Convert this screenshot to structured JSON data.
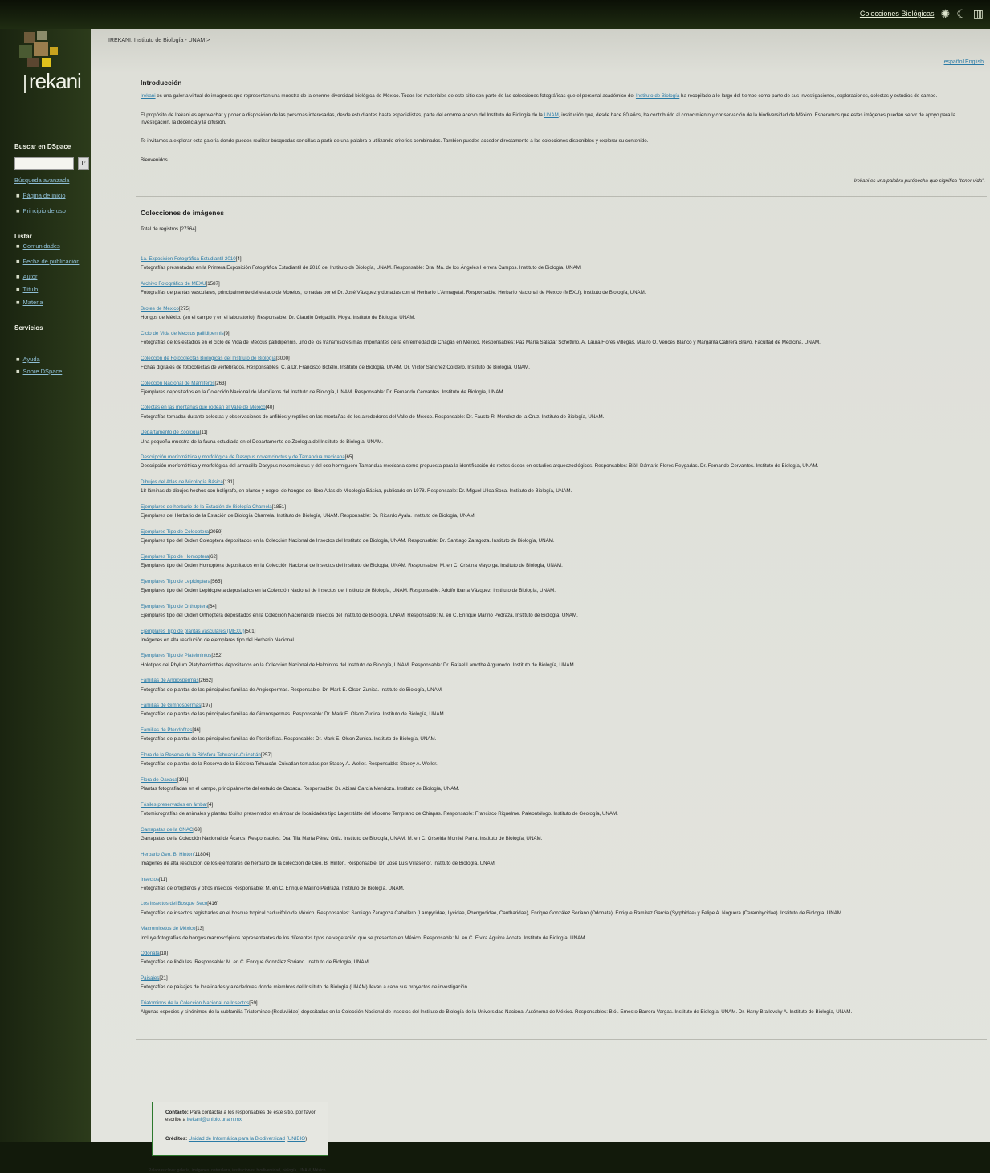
{
  "topbar": {
    "link": "Colecciones Biológicas",
    "icons": [
      "unam-seal-icon",
      "moon-icon",
      "building-icon"
    ]
  },
  "sidebar": {
    "logo_text": "rekani",
    "search": {
      "heading": "Buscar en DSpace",
      "button": "Ir",
      "advanced": "Búsqueda avanzada"
    },
    "top_links": [
      "Página de inicio",
      "Principio de uso"
    ],
    "listar": {
      "heading": "Listar",
      "items": [
        "Comunidades",
        "Fecha de publicación",
        "Autor",
        "Título",
        "Materia"
      ]
    },
    "servicios": {
      "heading": "Servicios",
      "items": [
        "Ayuda",
        "Sobre DSpace"
      ]
    }
  },
  "main": {
    "breadcrumb": "IREKANI. Instituto de Biología - UNAM >",
    "languages": "español English",
    "intro": {
      "heading": "Introducción",
      "p1_pre": "Irekani",
      "p1_a": " es una galería virtual de imágenes que representan una muestra de la enorme diversidad biológica de México. Todos los materiales de este sitio son parte de las colecciones fotográficas que el personal académico del ",
      "p1_link": "Instituto de Biología",
      "p1_b": " ha recopilado a lo largo del tiempo como parte de sus investigaciones, exploraciones, colectas y estudios de campo.",
      "p2_a": "El propósito de Irekani es aprovechar y poner a disposición de las personas interesadas, desde estudiantes hasta especialistas, parte del enorme acervo del Instituto de Biología de la ",
      "p2_link": "UNAM",
      "p2_b": ", institución que, desde hace 80 años, ha contribuido al conocimiento y conservación de la biodiversidad de México. Esperamos que estas imágenes puedan servir de apoyo para la investigación, la docencia y la difusión.",
      "p3": "Te invitamos a explorar esta galería donde puedes realizar búsquedas sencillas a partir de una palabra o utilizando criterios combinados. También puedes acceder directamente a las colecciones disponibles y explorar su contenido.",
      "p4": "Bienvenidos.",
      "note": "Irekani es una palabra purépecha que significa \"tener vida\"."
    },
    "collections": {
      "heading": "Colecciones de imágenes",
      "total": "Total de registros [27364]",
      "items": [
        {
          "name": "1a. Exposición Fotográfica Estudiantil 2010",
          "count": "[4]",
          "desc": "Fotografías presentadas en la Primera Exposición Fotográfica Estudiantil de 2010 del Instituto de Biología, UNAM. Responsable: Dra. Ma. de los Ángeles Herrera Campos. Instituto de Biología, UNAM."
        },
        {
          "name": "Archivo Fotográfico de MEXU",
          "count": "[1587]",
          "desc": "Fotografías de plantas vasculares, principalmente del estado de Morelos, tomadas por el Dr. José Vázquez y donadas con el Herbario L'Armagetal. Responsable: Herbario Nacional de México (MEXU). Instituto de Biología, UNAM."
        },
        {
          "name": "Brotes de México",
          "count": "[275]",
          "desc": "Hongos de México (en el campo y en el laboratorio). Responsable: Dr. Claudio Delgadillo Moya. Instituto de Biología, UNAM."
        },
        {
          "name": "Ciclo de Vida de Meccus pallidipennis",
          "count": "[9]",
          "desc": "Fotografías de los estadios en el ciclo de Vida de Meccus pallidipennis, uno de los transmisores más importantes de la enfermedad de Chagas en México. Responsables: Paz María Salazar Schettino, A. Laura Flores Villegas, Mauro O. Vences Blanco y Margarita Cabrera Bravo. Facultad de Medicina, UNAM."
        },
        {
          "name": "Colección de Fotocolectas Biológicas del Instituto de Biología",
          "count": "[3000]",
          "desc": "Fichas digitales de fotocolectas de vertebrados. Responsables: C. a Dr. Francisco Botello. Instituto de Biología, UNAM. Dr. Víctor Sánchez Cordero. Instituto de Biología, UNAM."
        },
        {
          "name": "Colección Nacional de Mamíferos",
          "count": "[263]",
          "desc": "Ejemplares depositados en la Colección Nacional de Mamíferos del Instituto de Biología, UNAM. Responsable: Dr. Fernando Cervantes. Instituto de Biología, UNAM."
        },
        {
          "name": "Colectas en las montañas que rodean el Valle de México",
          "count": "[40]",
          "desc": "Fotografías tomadas durante colectas y observaciones de anfibios y reptiles en las montañas de los alrededores del Valle de México. Responsable: Dr. Fausto R. Méndez de la Cruz. Instituto de Biología, UNAM."
        },
        {
          "name": "Departamento de Zoología",
          "count": "[11]",
          "desc": "Una pequeña muestra de la fauna estudiada en el Departamento de Zoología del Instituto de Biología, UNAM."
        },
        {
          "name": "Descripción morfométrica y morfológica de Dasypus novemcinctus y de Tamandua mexicana",
          "count": "[65]",
          "desc": "Descripción morfométrica y morfológica del armadillo Dasypus novemcinctus y del oso hormiguero Tamandua mexicana como propuesta para la identificación de restos óseos en estudios arqueozoológicos. Responsables: Biól. Dámaris Flores Reygadas. Dr. Fernando Cervantes. Instituto de Biología, UNAM."
        },
        {
          "name": "Dibujos del Atlas de Micología Básica",
          "count": "[131]",
          "desc": "18 láminas de dibujos hechos con bolígrafo, en blanco y negro, de hongos del libro Atlas de Micología Básica, publicado en 1978. Responsable: Dr. Miguel Ulloa Sosa. Instituto de Biología, UNAM."
        },
        {
          "name": "Ejemplares de herbario de la Estación de Biología Chamela",
          "count": "[1851]",
          "desc": "Ejemplares del Herbario de la Estación de Biología Chamela. Instituto de Biología, UNAM. Responsable: Dr. Ricardo Ayala. Instituto de Biología, UNAM."
        },
        {
          "name": "Ejemplares Tipo de Coleoptera",
          "count": "[2059]",
          "desc": "Ejemplares tipo del Orden Coleoptera depositados en la Colección Nacional de Insectos del Instituto de Biología, UNAM. Responsable: Dr. Santiago Zaragoza. Instituto de Biología, UNAM."
        },
        {
          "name": "Ejemplares Tipo de Homoptera",
          "count": "[62]",
          "desc": "Ejemplares tipo del Orden Homoptera depositados en la Colección Nacional de Insectos del Instituto de Biología, UNAM. Responsable: M. en C. Cristina Mayorga. Instituto de Biología, UNAM."
        },
        {
          "name": "Ejemplares Tipo de Lepidoptera",
          "count": "[565]",
          "desc": "Ejemplares tipo del Orden Lepidoptera depositados en la Colección Nacional de Insectos del Instituto de Biología, UNAM. Responsable: Adolfo Ibarra Vázquez. Instituto de Biología, UNAM."
        },
        {
          "name": "Ejemplares Tipo de Orthoptera",
          "count": "[64]",
          "desc": "Ejemplares tipo del Orden Orthoptera depositados en la Colección Nacional de Insectos del Instituto de Biología, UNAM. Responsable: M. en C. Enrique Mariño Pedraza. Instituto de Biología, UNAM."
        },
        {
          "name": "Ejemplares Tipo de plantas vasculares (MEXU)",
          "count": "[501]",
          "desc": "Imágenes en alta resolución de ejemplares tipo del Herbario Nacional."
        },
        {
          "name": "Ejemplares Tipo de Platelmintos",
          "count": "[252]",
          "desc": "Holotipos del Phylum Platyhelminthes depositados en la Colección Nacional de Helmintos del Instituto de Biología, UNAM. Responsable: Dr. Rafael Lamothe Argumedo. Instituto de Biología, UNAM."
        },
        {
          "name": "Familias de Angiospermas",
          "count": "[2662]",
          "desc": "Fotografías de plantas de las principales familias de Angiospermas. Responsable: Dr. Mark E. Olson Zunica. Instituto de Biología, UNAM."
        },
        {
          "name": "Familias de Gimnospermas",
          "count": "[197]",
          "desc": "Fotografías de plantas de las principales familias de Gimnospermas. Responsable: Dr. Mark E. Olson Zunica. Instituto de Biología, UNAM."
        },
        {
          "name": "Familias de Pteridofitas",
          "count": "[46]",
          "desc": "Fotografías de plantas de las principales familias de Pteridofitas. Responsable: Dr. Mark E. Olson Zunica. Instituto de Biología, UNAM."
        },
        {
          "name": "Flora de la Reserva de la Biósfera Tehuacán-Cuicatlán",
          "count": "[257]",
          "desc": "Fotografías de plantas de la Reserva de la Biósfera Tehuacán-Cuicatlán tomadas por Stacey A. Weller. Responsable: Stacey A. Weller."
        },
        {
          "name": "Flora de Oaxaca",
          "count": "[191]",
          "desc": "Plantas fotografiadas en el campo, principalmente del estado de Oaxaca. Responsable: Dr. Abisaí García Mendoza. Instituto de Biología, UNAM."
        },
        {
          "name": "Fósiles preservados en ámbar",
          "count": "[4]",
          "desc": "Fotomicrografías de animales y plantas fósiles preservados en ámbar de localidades tipo Lagerstätte del Mioceno Temprano de Chiapas. Responsable: Francisco Riquelme. Paleontólogo. Instituto de Geología, UNAM."
        },
        {
          "name": "Garrapatas de la CNAC",
          "count": "[63]",
          "desc": "Garrapatas de la Colección Nacional de Ácaros. Responsables: Dra. Tila María Pérez Ortiz. Instituto de Biología, UNAM. M. en C. Griselda Montiel Parra. Instituto de Biología, UNAM."
        },
        {
          "name": "Herbario Geo. B. Hinton",
          "count": "[11804]",
          "desc": "Imágenes de alta resolución de los ejemplares de herbario de la colección de Geo. B. Hinton. Responsable: Dr. José Luis Villaseñor. Instituto de Biología, UNAM."
        },
        {
          "name": "Insectos",
          "count": "[11]",
          "desc": "Fotografías de ortópteros y otros insectos Responsable: M. en C. Enrique Mariño Pedraza. Instituto de Biología, UNAM."
        },
        {
          "name": "Los Insectos del Bosque Seco",
          "count": "[416]",
          "desc": "Fotografías de insectos registrados en el bosque tropical caducifolio de México. Responsables: Santiago Zaragoza Caballero (Lampyridae, Lycidae, Phengodidae, Cantharidae), Enrique González Soriano (Odonata), Enrique Ramírez García (Syrphidae) y Felipe A. Noguera (Cerambycidae). Instituto de Biología, UNAM."
        },
        {
          "name": "Macromicetos de México",
          "count": "[13]",
          "desc": "Incluye fotografías de hongos macroscópicos representantes de los diferentes tipos de vegetación que se presentan en México. Responsable: M. en C. Elvira Aguirre Acosta. Instituto de Biología, UNAM."
        },
        {
          "name": "Odonata",
          "count": "[18]",
          "desc": "Fotografías de libélulas. Responsable: M. en C. Enrique González Soriano. Instituto de Biología, UNAM."
        },
        {
          "name": "Paisajes",
          "count": "[21]",
          "desc": "Fotografías de paisajes de localidades y alrededores donde miembros del Instituto de Biología (UNAM) llevan a cabo sus proyectos de investigación."
        },
        {
          "name": "Triatominos de la Colección Nacional de Insectos",
          "count": "[59]",
          "desc": "Algunas especies y sinónimos de la subfamilia Triatominae (Reduviidae) depositadas en la Colección Nacional de Insectos del Instituto de Biología de la Universidad Nacional Autónoma de México. Responsables: Biól. Ernesto Barrera Vargas. Instituto de Biología, UNAM. Dr. Harry Brailovsky A. Instituto de Biología, UNAM."
        }
      ]
    },
    "footer": {
      "contact_label": "Contacto:",
      "contact_text": " Para contactar a los responsables de este sitio, por favor escribe a ",
      "contact_email": "irekani@unibio.unam.mx",
      "credits_label": "Créditos:",
      "credits_link": "Unidad de Informática para la Biodiversidad",
      "credits_acr": "UNIBIO",
      "keywords": "Palabras clave: galería, imágenes, naturaleza, instituciones, biodiversidad, biología, UNAM, México"
    }
  }
}
